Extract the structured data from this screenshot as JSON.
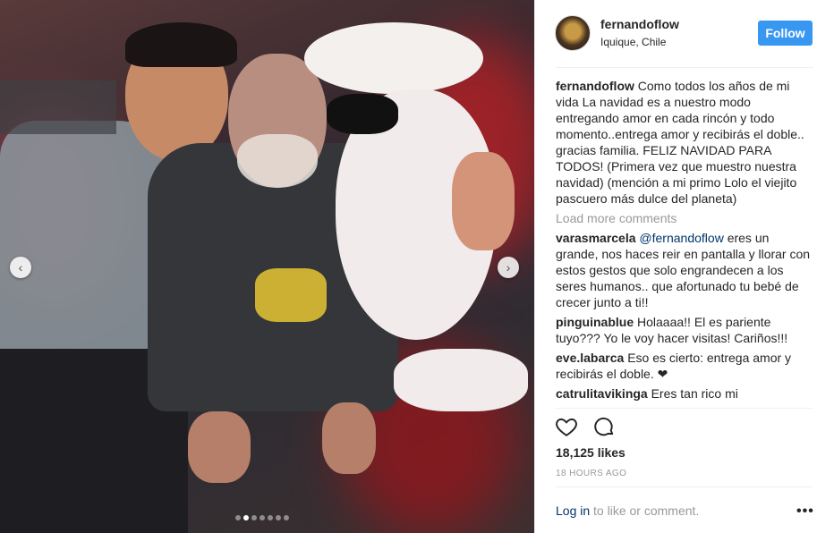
{
  "post": {
    "username": "fernandoflow",
    "location": "Iquique, Chile",
    "follow_label": "Follow",
    "caption": {
      "user": "fernandoflow",
      "text": "Como todos los años de mi vida La navidad es a nuestro modo entregando amor en cada rincón y todo momento..entrega amor y recibirás el doble.. gracias familia. FELIZ NAVIDAD PARA TODOS! (Primera vez que muestro nuestra navidad) (mención a mi primo Lolo el viejito pascuero más dulce del planeta)"
    },
    "load_more": "Load more comments",
    "comments": [
      {
        "user": "varasmarcela",
        "mention": "@fernandoflow",
        "text": " eres un grande, nos haces reir en pantalla y llorar con estos gestos que solo engrandecen a los seres humanos.. que afortunado tu bebé de crecer junto a ti!!"
      },
      {
        "user": "pinguinablue",
        "mention": "",
        "text": "Holaaaa!! El es pariente tuyo??? Yo le voy hacer visitas! Cariños!!!"
      },
      {
        "user": "eve.labarca",
        "mention": "",
        "text": "Eso es cierto: entrega amor y recibirás el doble. ❤"
      },
      {
        "user": "catrulitavikinga",
        "mention": "",
        "text": "Eres tan rico mi"
      }
    ],
    "likes": "18,125 likes",
    "timestamp": "18 HOURS AGO",
    "login_link": "Log in",
    "login_rest": " to like or comment.",
    "more_label": "•••"
  },
  "carousel": {
    "prev_label": "‹",
    "next_label": "›",
    "slide_count": 7,
    "active_index": 1
  },
  "icons": [
    "heart-icon",
    "comment-icon",
    "more-options-icon",
    "chevron-left-icon",
    "chevron-right-icon"
  ],
  "colors": {
    "accent": "#3897f0",
    "link": "#003569",
    "muted": "#999999"
  }
}
